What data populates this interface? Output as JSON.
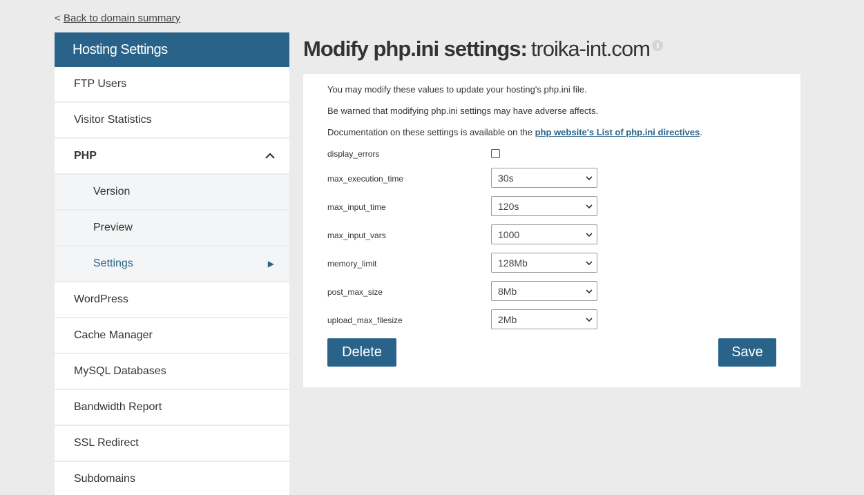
{
  "back": {
    "prefix": "<",
    "label": "Back to domain summary"
  },
  "sidebar": {
    "title": "Hosting Settings",
    "items": [
      {
        "label": "FTP Users"
      },
      {
        "label": "Visitor Statistics"
      },
      {
        "label": "PHP"
      },
      {
        "label": "Version"
      },
      {
        "label": "Preview"
      },
      {
        "label": "Settings"
      },
      {
        "label": "WordPress"
      },
      {
        "label": "Cache Manager"
      },
      {
        "label": "MySQL Databases"
      },
      {
        "label": "Bandwidth Report"
      },
      {
        "label": "SSL Redirect"
      },
      {
        "label": "Subdomains"
      }
    ]
  },
  "main": {
    "title_label": "Modify php.ini settings:",
    "title_domain": "troika-int.com",
    "info_icon": "i",
    "intro1": "You may modify these values to update your hosting's php.ini file.",
    "intro2": "Be warned that modifying php.ini settings may have adverse affects.",
    "intro3_prefix": "Documentation on these settings is available on the ",
    "intro3_link": "php website's List of php.ini directives",
    "intro3_suffix": ".",
    "settings": [
      {
        "name": "display_errors",
        "type": "checkbox",
        "checked": false
      },
      {
        "name": "max_execution_time",
        "value": "30s"
      },
      {
        "name": "max_input_time",
        "value": "120s"
      },
      {
        "name": "max_input_vars",
        "value": "1000"
      },
      {
        "name": "memory_limit",
        "value": "128Mb"
      },
      {
        "name": "post_max_size",
        "value": "8Mb"
      },
      {
        "name": "upload_max_filesize",
        "value": "2Mb"
      }
    ],
    "delete_label": "Delete",
    "save_label": "Save"
  },
  "colors": {
    "accent": "#2a6389",
    "background": "#ebebeb"
  }
}
